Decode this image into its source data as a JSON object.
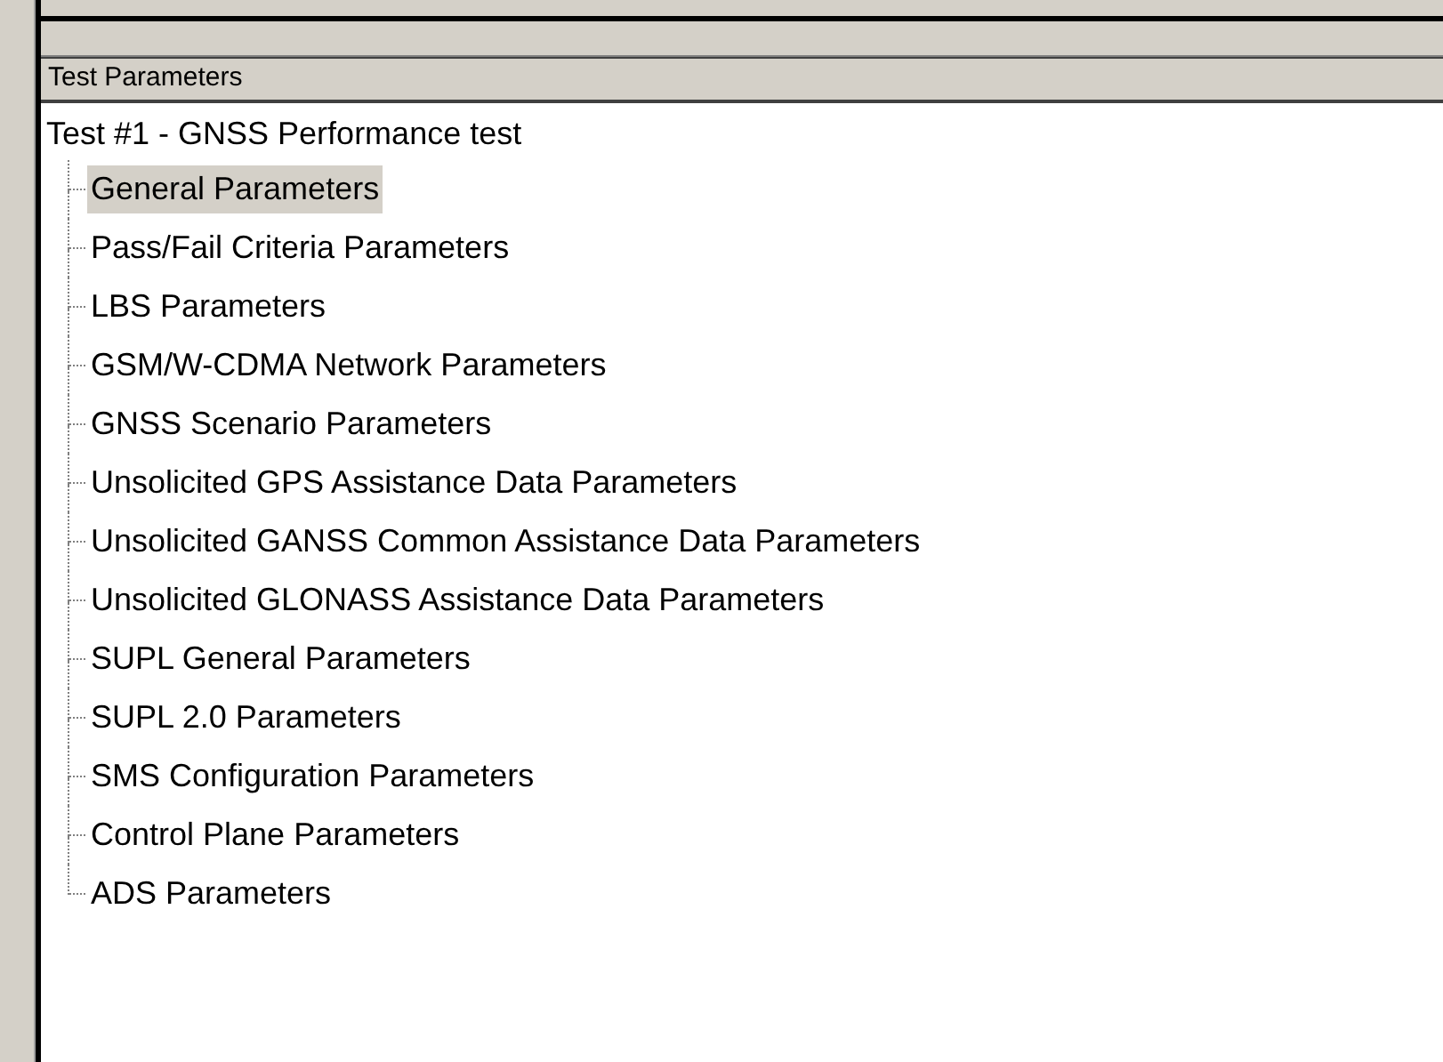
{
  "panel": {
    "title": "Test Parameters"
  },
  "tree": {
    "label": "Test #1 - GNSS Performance test",
    "children": [
      {
        "label": "General Parameters",
        "selected": true
      },
      {
        "label": "Pass/Fail Criteria Parameters",
        "selected": false
      },
      {
        "label": "LBS Parameters",
        "selected": false
      },
      {
        "label": "GSM/W-CDMA Network Parameters",
        "selected": false
      },
      {
        "label": "GNSS Scenario Parameters",
        "selected": false
      },
      {
        "label": "Unsolicited GPS Assistance Data Parameters",
        "selected": false
      },
      {
        "label": "Unsolicited GANSS Common Assistance Data Parameters",
        "selected": false
      },
      {
        "label": "Unsolicited GLONASS Assistance Data Parameters",
        "selected": false
      },
      {
        "label": "SUPL General Parameters",
        "selected": false
      },
      {
        "label": "SUPL 2.0 Parameters",
        "selected": false
      },
      {
        "label": "SMS Configuration Parameters",
        "selected": false
      },
      {
        "label": "Control Plane Parameters",
        "selected": false
      },
      {
        "label": "ADS Parameters",
        "selected": false
      }
    ]
  }
}
